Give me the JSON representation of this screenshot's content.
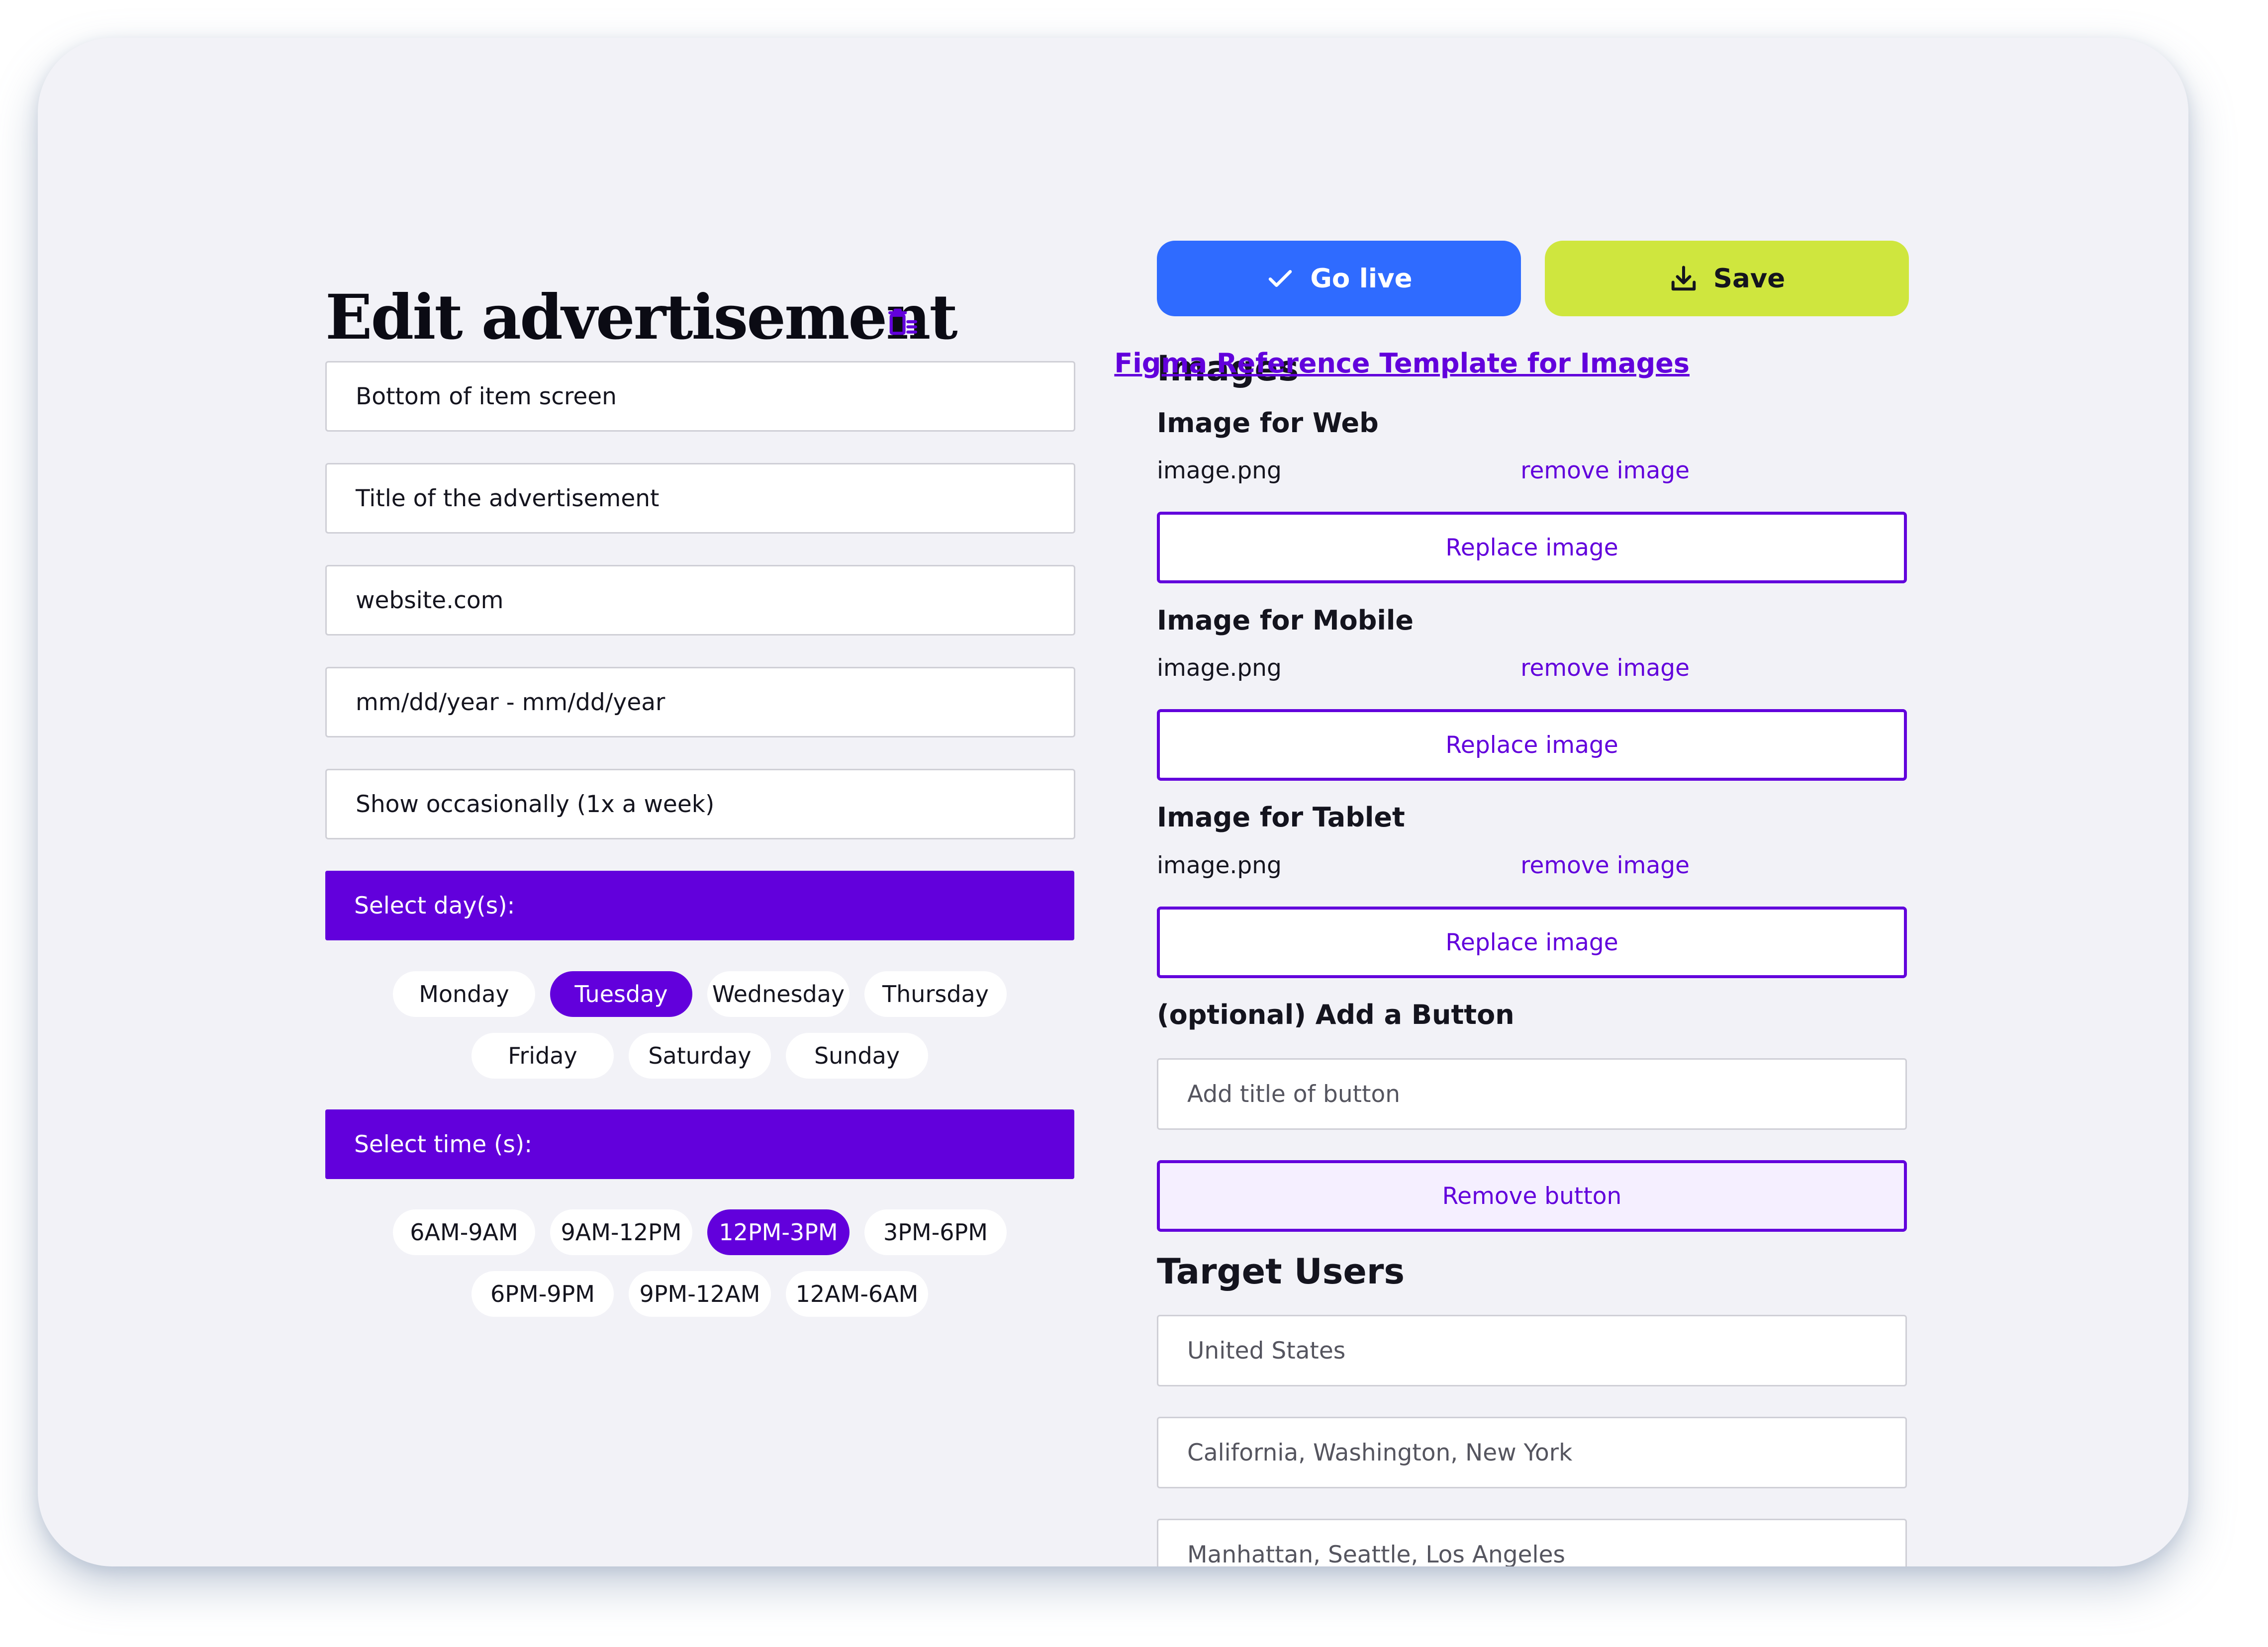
{
  "title": "Edit advertisement",
  "left": {
    "fields": [
      "Bottom of item screen",
      "Title of the advertisement",
      "website.com",
      "mm/dd/year - mm/dd/year",
      "Show occasionally (1x a week)"
    ],
    "select_days_label": "Select day(s):",
    "days_row1": [
      "Monday",
      "Tuesday",
      "Wednesday",
      "Thursday"
    ],
    "days_row2": [
      "Friday",
      "Saturday",
      "Sunday"
    ],
    "select_time_label": "Select time (s):",
    "times_row1": [
      "6AM-9AM",
      "9AM-12PM",
      "12PM-3PM",
      "3PM-6PM"
    ],
    "times_row2": [
      "6PM-9PM",
      "9PM-12AM",
      "12AM-6AM"
    ],
    "selected_day": "Tuesday",
    "selected_time": "12PM-3PM"
  },
  "actions": {
    "go_live": "Go live",
    "save": "Save"
  },
  "images": {
    "heading": "Images",
    "reference_link": "Figma Reference Template for Images",
    "web": {
      "label": "Image for Web",
      "file": "image.png",
      "remove": "remove image",
      "replace": "Replace image"
    },
    "mobile": {
      "label": "Image for Mobile",
      "file": "image.png",
      "remove": "remove image",
      "replace": "Replace image"
    },
    "tablet": {
      "label": "Image for Tablet",
      "file": "image.png",
      "remove": "remove image",
      "replace": "Replace image"
    }
  },
  "button_section": {
    "heading": "(optional) Add a Button",
    "title_placeholder": "Add title of button",
    "remove_label": "Remove button"
  },
  "target_users": {
    "heading": "Target Users",
    "country": "United States",
    "states": "California, Washington, New York",
    "cities": "Manhattan, Seattle, Los Angeles"
  },
  "colors": {
    "accent": "#6200dc",
    "go_live": "#2f6bff",
    "save": "#cfe63e",
    "background": "#f2f2f7"
  }
}
